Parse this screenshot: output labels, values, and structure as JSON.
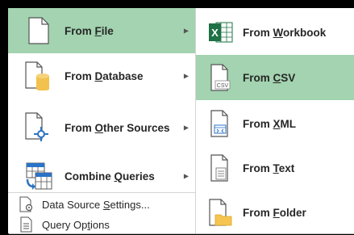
{
  "main_menu": {
    "items": [
      {
        "pre": "From ",
        "key": "F",
        "post": "ile",
        "has_submenu": true,
        "active": true
      },
      {
        "pre": "From ",
        "key": "D",
        "post": "atabase",
        "has_submenu": true
      },
      {
        "pre": "From ",
        "key": "O",
        "post": "ther Sources",
        "has_submenu": true
      },
      {
        "pre": "Combine ",
        "key": "Q",
        "post": "ueries",
        "has_submenu": true
      }
    ],
    "small_items": [
      {
        "pre": "Data Source ",
        "key": "S",
        "post": "ettings..."
      },
      {
        "pre": "Query Op",
        "key": "t",
        "post": "ions"
      }
    ],
    "arrow_glyph": "▶"
  },
  "sub_menu": {
    "items": [
      {
        "pre": "From ",
        "key": "W",
        "post": "orkbook"
      },
      {
        "pre": "From ",
        "key": "C",
        "post": "SV",
        "active": true
      },
      {
        "pre": "From ",
        "key": "X",
        "post": "ML"
      },
      {
        "pre": "From ",
        "key": "T",
        "post": "ext"
      },
      {
        "pre": "From ",
        "key": "F",
        "post": "older"
      }
    ],
    "csv_icon_text": "CSV",
    "excel_icon_letter": "X"
  },
  "colors": {
    "highlight": "#a3d3b0",
    "excel_green": "#1e7145",
    "database_gold": "#f2c14e",
    "folder_gold": "#f5c54f",
    "blue_accent": "#2b73c7"
  }
}
